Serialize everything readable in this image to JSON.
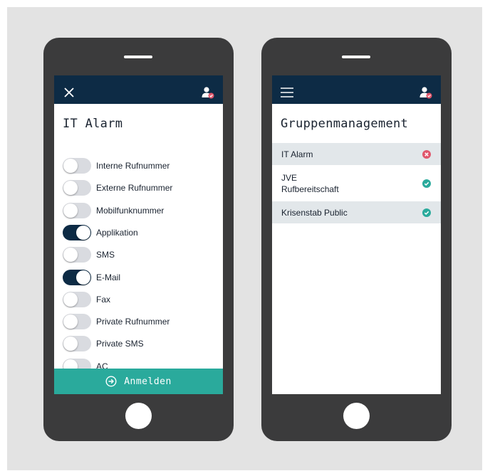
{
  "left_phone": {
    "close_icon": "close-icon",
    "user_icon": "user-check-icon",
    "title": "IT Alarm",
    "toggles": [
      {
        "label": "Interne Rufnummer",
        "on": false
      },
      {
        "label": "Externe Rufnummer",
        "on": false
      },
      {
        "label": "Mobilfunknummer",
        "on": false
      },
      {
        "label": "Applikation",
        "on": true
      },
      {
        "label": "SMS",
        "on": false
      },
      {
        "label": "E-Mail",
        "on": true
      },
      {
        "label": "Fax",
        "on": false
      },
      {
        "label": "Private Rufnummer",
        "on": false
      },
      {
        "label": "Private SMS",
        "on": false
      },
      {
        "label": "AC",
        "on": false
      }
    ],
    "login_icon": "login-arrow-icon",
    "login_label": "Anmelden"
  },
  "right_phone": {
    "menu_icon": "hamburger-menu-icon",
    "user_icon": "user-check-icon",
    "title": "Gruppenmanagement",
    "groups": [
      {
        "label": "IT Alarm",
        "status": "error"
      },
      {
        "label": "JVE\nRufbereitschaft",
        "status": "ok"
      },
      {
        "label": "Krisenstab Public",
        "status": "ok"
      }
    ]
  },
  "colors": {
    "topbar": "#0d2b45",
    "accent_teal": "#2aaa9c",
    "status_ok": "#2aaa9c",
    "status_error": "#e0566b",
    "phone_body": "#3b3b3c",
    "background": "#e3e3e3"
  }
}
